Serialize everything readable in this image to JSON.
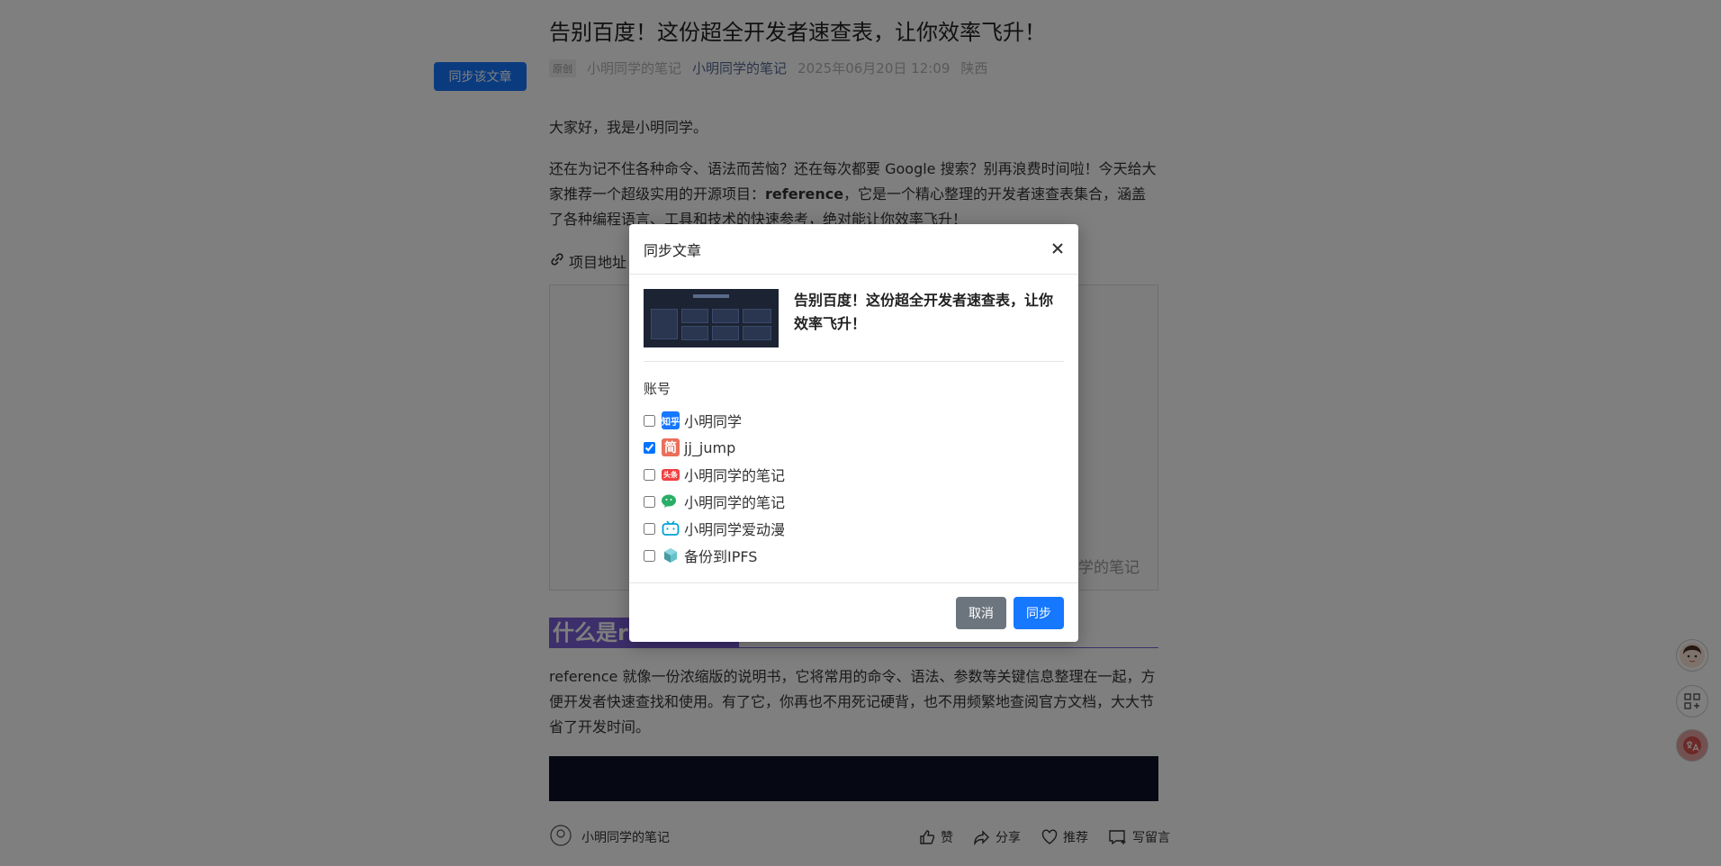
{
  "colors": {
    "accent": "#1677ff",
    "heading_bg": "#7a5fd6",
    "cancel": "#6c757d"
  },
  "page": {
    "sync_article_button": "同步该文章",
    "article_title": "告别百度！这份超全开发者速查表，让你效率飞升！",
    "meta": {
      "badge": "原创",
      "author": "小明同学的笔记",
      "account": "小明同学的笔记",
      "datetime": "2025年06月20日 12:09",
      "location": "陕西"
    },
    "para1": "大家好，我是小明同学。",
    "para2_a": "还在为记不住各种命令、语法而苦恼？还在每次都要 Google 搜索？别再浪费时间啦！今天给大家推荐一个超级实用的开源项目：",
    "para2_bold": "reference",
    "para2_b": "，它是一个精心整理的开发者速查表集合，涵盖了各种编程语言、工具和技术的快速参考，绝对能让你效率飞升！",
    "project_label": "项目地址",
    "screenshot_watermark": "学的笔记",
    "section_heading": "什么是reference",
    "para3": "reference 就像一份浓缩版的说明书，它将常用的命令、语法、参数等关键信息整理在一起，方便开发者快速查找和使用。有了它，你再也不用死记硬背，也不用频繁地查阅官方文档，大大节省了开发时间。",
    "bottom_bar": {
      "author": "小明同学的笔记",
      "like": "赞",
      "share": "分享",
      "recommend": "推荐",
      "comment": "写留言"
    }
  },
  "modal": {
    "title": "同步文章",
    "close_icon": "close-icon",
    "preview_title": "告别百度！这份超全开发者速查表，让你效率飞升！",
    "account_label": "账号",
    "accounts": [
      {
        "icon": "zhihu-icon",
        "icon_text": "知乎",
        "name": "小明同学",
        "checked": false
      },
      {
        "icon": "jianshu-icon",
        "icon_text": "简",
        "name": "jj_jump",
        "checked": true
      },
      {
        "icon": "toutiao-icon",
        "icon_text": "头条",
        "name": "小明同学的笔记",
        "checked": false
      },
      {
        "icon": "wechat-icon",
        "icon_text": "",
        "name": "小明同学的笔记",
        "checked": false
      },
      {
        "icon": "bilibili-icon",
        "icon_text": "",
        "name": "小明同学爱动漫",
        "checked": false
      },
      {
        "icon": "ipfs-icon",
        "icon_text": "",
        "name": "备份到IPFS",
        "checked": false
      }
    ],
    "cancel_label": "取消",
    "sync_label": "同步"
  }
}
